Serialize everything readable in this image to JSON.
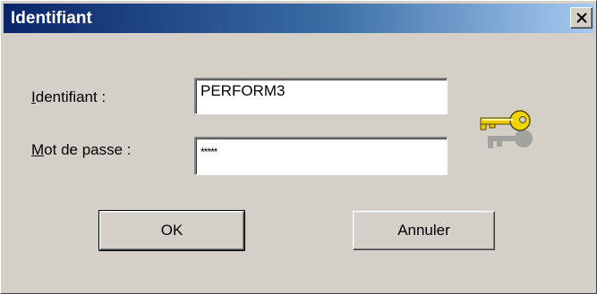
{
  "window": {
    "title": "Identifiant"
  },
  "form": {
    "login_label_first": "I",
    "login_label_rest": "dentifiant :",
    "login_value": "PERFORM3",
    "password_label_first": "M",
    "password_label_rest": "ot de passe :",
    "password_value": "*****"
  },
  "buttons": {
    "ok_label": "OK",
    "cancel_label": "Annuler"
  },
  "icons": {
    "close": "close-icon",
    "key": "key-icon"
  },
  "colors": {
    "title_start": "#0a246a",
    "title_end": "#a6caf0",
    "dialog_bg": "#d4d0c8",
    "key_gold": "#e8c800"
  }
}
